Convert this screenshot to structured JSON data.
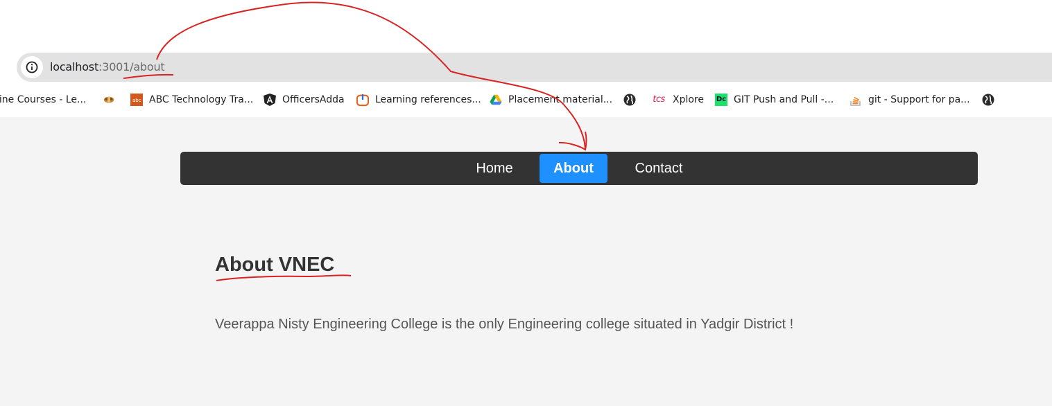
{
  "browser": {
    "url": {
      "host": "localhost",
      "rest": ":3001/about"
    },
    "bookmarks": [
      {
        "label": "line Courses - Le...",
        "icon": "course-icon"
      },
      {
        "label": "",
        "icon": "emblem-icon"
      },
      {
        "label": "ABC Technology Tra...",
        "icon": "abc-icon"
      },
      {
        "label": "OfficersAdda",
        "icon": "angular-icon"
      },
      {
        "label": "Learning references...",
        "icon": "power-icon"
      },
      {
        "label": "Placement material...",
        "icon": "drive-icon"
      },
      {
        "label": "",
        "icon": "globe-icon"
      },
      {
        "label": "Xplore",
        "icon": "tcs-icon",
        "icon_text": "tcs"
      },
      {
        "label": "GIT Push and Pull -...",
        "icon": "dc-icon",
        "icon_text": "Dc"
      },
      {
        "label": "git - Support for pa...",
        "icon": "stackoverflow-icon"
      },
      {
        "label": "",
        "icon": "globe-icon"
      }
    ]
  },
  "nav": {
    "items": [
      {
        "label": "Home",
        "active": false
      },
      {
        "label": "About",
        "active": true
      },
      {
        "label": "Contact",
        "active": false
      }
    ]
  },
  "content": {
    "title": "About VNEC",
    "description": "Veerappa Nisty Engineering College is the only Engineering college situated in Yadgir District !"
  },
  "colors": {
    "navbar": "#333333",
    "active": "#1e90ff",
    "page_bg": "#f4f4f4",
    "annotation": "#d92323"
  }
}
